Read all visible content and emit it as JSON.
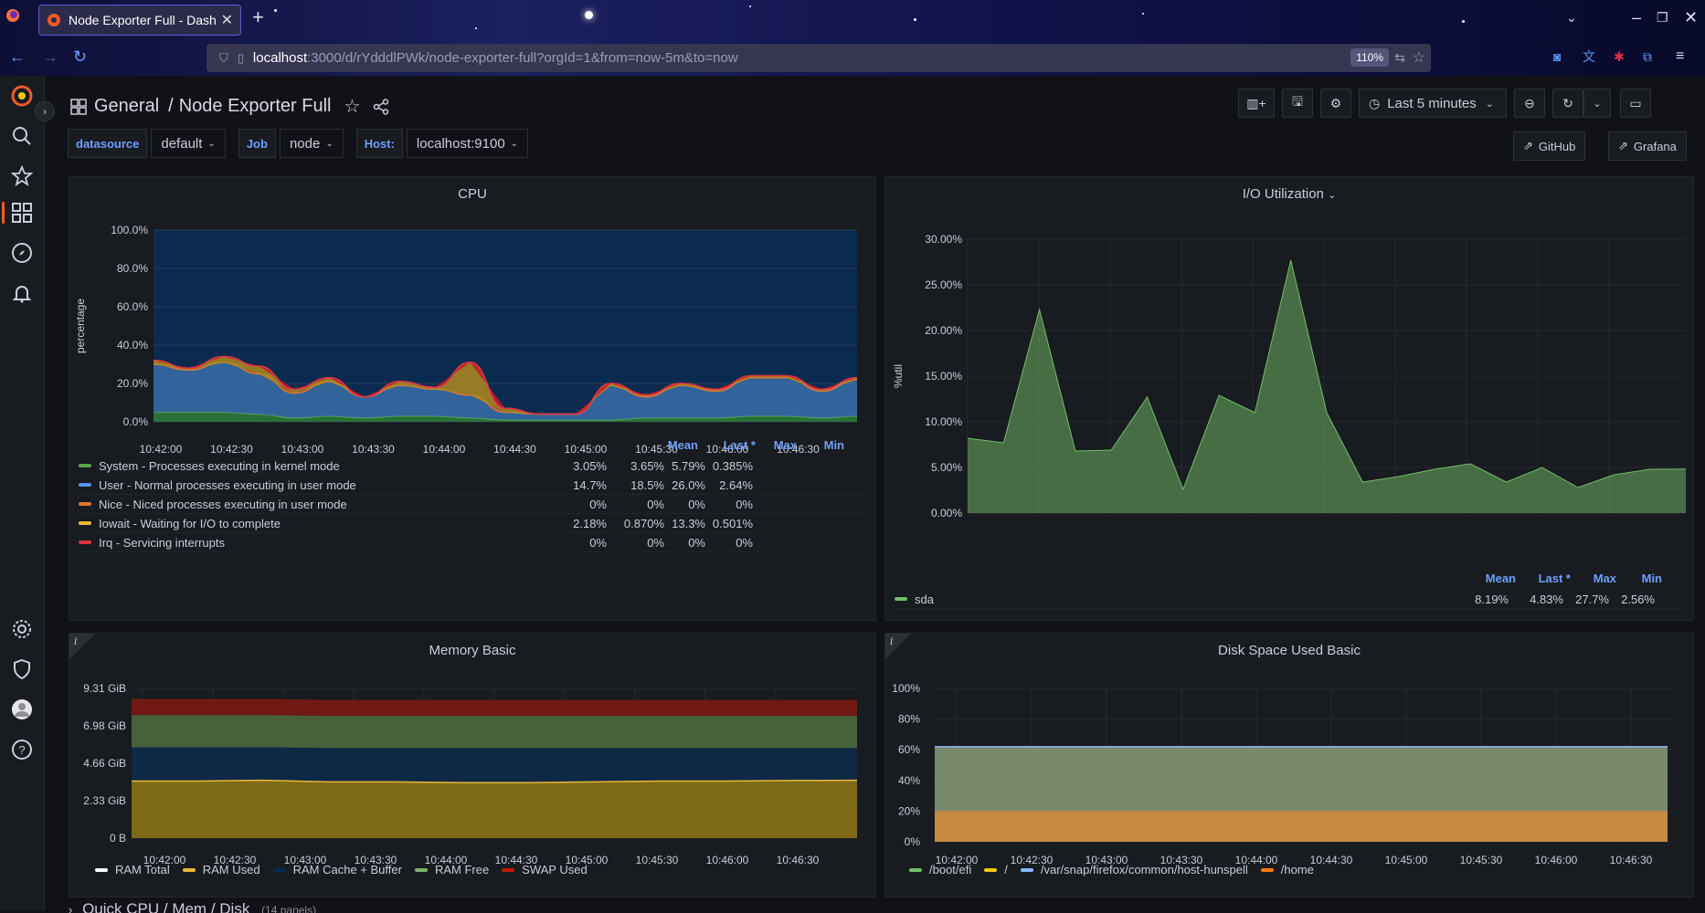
{
  "browser": {
    "tab_title": "Node Exporter Full - Dash",
    "url_host": "localhost",
    "url_rest": ":3000/d/rYdddlPWk/node-exporter-full?orgId=1&from=now-5m&to=now",
    "zoom": "110%"
  },
  "dashboard": {
    "folder": "General",
    "separator": "/",
    "title": "Node Exporter Full",
    "time_range": "Last 5 minutes",
    "links": {
      "github": "GitHub",
      "grafana": "Grafana"
    }
  },
  "variables": [
    {
      "label": "datasource",
      "value": "default"
    },
    {
      "label": "Job",
      "value": "node"
    },
    {
      "label": "Host:",
      "value": "localhost:9100"
    }
  ],
  "colors": {
    "accent": "#f05a28",
    "blue_label": "#6e9fff",
    "panel_bg": "#181b1f"
  },
  "time_ticks": [
    "10:42:00",
    "10:42:30",
    "10:43:00",
    "10:43:30",
    "10:44:00",
    "10:44:30",
    "10:45:00",
    "10:45:30",
    "10:46:00",
    "10:46:30"
  ],
  "cpu": {
    "title": "CPU",
    "ylabel": "percentage",
    "yticks": [
      "100.0%",
      "80.0%",
      "60.0%",
      "40.0%",
      "20.0%",
      "0.0%"
    ],
    "columns": [
      "Mean",
      "Last *",
      "Max",
      "Min"
    ],
    "rows": [
      {
        "name": "System - Processes executing in kernel mode",
        "color": "#56a64b",
        "mean": "3.05%",
        "last": "3.65%",
        "max": "5.79%",
        "min": "0.385%"
      },
      {
        "name": "User - Normal processes executing in user mode",
        "color": "#5794f2",
        "mean": "14.7%",
        "last": "18.5%",
        "max": "26.0%",
        "min": "2.64%"
      },
      {
        "name": "Nice - Niced processes executing in user mode",
        "color": "#e0752d",
        "mean": "0%",
        "last": "0%",
        "max": "0%",
        "min": "0%"
      },
      {
        "name": "Iowait - Waiting for I/O to complete",
        "color": "#eab839",
        "mean": "2.18%",
        "last": "0.870%",
        "max": "13.3%",
        "min": "0.501%"
      },
      {
        "name": "Irq - Servicing interrupts",
        "color": "#e02f44",
        "mean": "0%",
        "last": "0%",
        "max": "0%",
        "min": "0%"
      }
    ]
  },
  "io": {
    "title": "I/O Utilization",
    "ylabel": "%util",
    "yticks": [
      "30.00%",
      "25.00%",
      "20.00%",
      "15.00%",
      "10.00%",
      "5.00%",
      "0.00%"
    ],
    "columns": [
      "Mean",
      "Last *",
      "Max",
      "Min"
    ],
    "series": {
      "name": "sda",
      "color": "#73bf69",
      "mean": "8.19%",
      "last": "4.83%",
      "max": "27.7%",
      "min": "2.56%"
    }
  },
  "memory": {
    "title": "Memory Basic",
    "info": "i",
    "yticks": [
      "9.31 GiB",
      "6.98 GiB",
      "4.66 GiB",
      "2.33 GiB",
      "0 B"
    ],
    "legend": [
      {
        "name": "RAM Total",
        "color": "#ffffff"
      },
      {
        "name": "RAM Used",
        "color": "#eab839"
      },
      {
        "name": "RAM Cache + Buffer",
        "color": "#052b51"
      },
      {
        "name": "RAM Free",
        "color": "#7eb26d"
      },
      {
        "name": "SWAP Used",
        "color": "#bf1b00"
      }
    ]
  },
  "disk": {
    "title": "Disk Space Used Basic",
    "info": "i",
    "yticks": [
      "100%",
      "80%",
      "60%",
      "40%",
      "20%",
      "0%"
    ],
    "legend": [
      {
        "name": "/boot/efi",
        "color": "#73bf69"
      },
      {
        "name": "/",
        "color": "#f2cc0c"
      },
      {
        "name": "/var/snap/firefox/common/host-hunspell",
        "color": "#8ab8ff"
      },
      {
        "name": "/home",
        "color": "#ff780a"
      }
    ]
  },
  "bottom_row": {
    "title": "Quick CPU / Mem / Disk",
    "count": "(14 panels)"
  },
  "chart_data": [
    {
      "type": "area",
      "title": "CPU",
      "ylabel": "percentage",
      "ylim": [
        0,
        100
      ],
      "x": [
        "10:41:45",
        "10:42:00",
        "10:42:15",
        "10:42:30",
        "10:42:45",
        "10:43:00",
        "10:43:15",
        "10:43:30",
        "10:43:45",
        "10:44:00",
        "10:44:15",
        "10:44:30",
        "10:44:45",
        "10:45:00",
        "10:45:15",
        "10:45:30",
        "10:45:45",
        "10:46:00",
        "10:46:15",
        "10:46:30",
        "10:46:45"
      ],
      "series": [
        {
          "name": "System - Processes executing in kernel mode",
          "values": [
            5,
            5,
            5,
            4,
            2,
            3,
            2,
            3,
            3,
            2,
            1,
            1,
            1,
            1,
            2,
            2,
            2,
            3,
            3,
            2,
            3
          ]
        },
        {
          "name": "User - Normal processes executing in user mode",
          "values": [
            25,
            22,
            26,
            21,
            13,
            18,
            11,
            16,
            14,
            12,
            4,
            3,
            3,
            18,
            11,
            17,
            14,
            20,
            20,
            14,
            19
          ]
        },
        {
          "name": "Nice - Niced processes executing in user mode",
          "values": [
            0,
            0,
            0,
            0,
            0,
            0,
            0,
            0,
            0,
            0,
            0,
            0,
            0,
            0,
            0,
            0,
            0,
            0,
            0,
            0,
            0
          ]
        },
        {
          "name": "Iowait - Waiting for I/O to complete",
          "values": [
            2,
            1,
            3,
            4,
            2,
            2,
            0,
            2,
            1,
            17,
            2,
            0,
            0,
            1,
            1,
            1,
            1,
            1,
            1,
            1,
            1
          ]
        },
        {
          "name": "Irq - Servicing interrupts",
          "values": [
            0,
            0,
            0,
            0,
            0,
            0,
            0,
            0,
            0,
            0,
            0,
            0,
            0,
            0,
            0,
            0,
            0,
            0,
            0,
            0,
            0
          ]
        }
      ]
    },
    {
      "type": "area",
      "title": "I/O Utilization",
      "ylabel": "%util",
      "ylim": [
        0,
        30
      ],
      "series": [
        {
          "name": "sda",
          "values": [
            8.2,
            7.7,
            22.3,
            6.8,
            6.9,
            12.7,
            2.6,
            12.9,
            11.0,
            27.7,
            11.0,
            3.4,
            4.0,
            4.8,
            5.4,
            3.4,
            5.0,
            2.8,
            4.2,
            4.8,
            4.83
          ]
        }
      ]
    },
    {
      "type": "area",
      "title": "Memory Basic",
      "ylim": [
        0,
        9.31
      ],
      "series": [
        {
          "name": "RAM Total",
          "values": [
            7.65
          ]
        },
        {
          "name": "RAM Used",
          "values": [
            3.55,
            3.55,
            3.6,
            3.5,
            3.5,
            3.45,
            3.45,
            3.5,
            3.55,
            3.55,
            3.58,
            3.6
          ]
        },
        {
          "name": "RAM Cache + Buffer",
          "values": [
            2.1,
            2.1,
            2.05,
            2.1,
            2.1,
            2.15,
            2.15,
            2.1,
            2.05,
            2.05,
            2.02,
            2.0
          ]
        },
        {
          "name": "RAM Free",
          "values": [
            2.0
          ]
        },
        {
          "name": "SWAP Used",
          "values": [
            1.0
          ]
        }
      ]
    },
    {
      "type": "area",
      "title": "Disk Space Used Basic",
      "ylim": [
        0,
        100
      ],
      "series": [
        {
          "name": "/boot/efi",
          "values": [
            62
          ]
        },
        {
          "name": "/",
          "values": [
            62
          ]
        },
        {
          "name": "/var/snap/firefox/common/host-hunspell",
          "values": [
            62
          ]
        },
        {
          "name": "/home",
          "values": [
            20
          ]
        }
      ]
    }
  ]
}
